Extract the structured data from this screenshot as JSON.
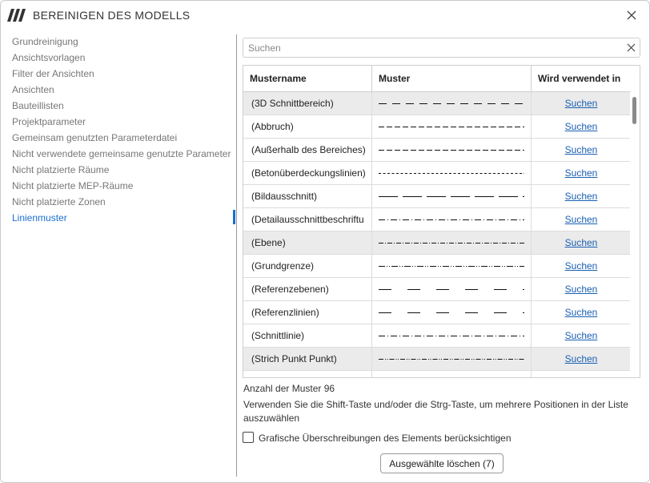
{
  "window": {
    "title": "BEREINIGEN DES MODELLS",
    "logo_icon": "app-logo-icon",
    "close_icon": "close-icon"
  },
  "sidebar": {
    "items": [
      {
        "label": "Grundreinigung",
        "active": false
      },
      {
        "label": "Ansichtsvorlagen",
        "active": false
      },
      {
        "label": "Filter der Ansichten",
        "active": false
      },
      {
        "label": "Ansichten",
        "active": false
      },
      {
        "label": "Bauteillisten",
        "active": false
      },
      {
        "label": "Projektparameter",
        "active": false
      },
      {
        "label": "Gemeinsam genutzten Parameterdatei",
        "active": false
      },
      {
        "label": "Nicht verwendete gemeinsame genutzte Parameter",
        "active": false
      },
      {
        "label": "Nicht platzierte Räume",
        "active": false
      },
      {
        "label": "Nicht platzierte MEP-Räume",
        "active": false
      },
      {
        "label": "Nicht platzierte Zonen",
        "active": false
      },
      {
        "label": "Linienmuster",
        "active": true
      }
    ]
  },
  "search": {
    "placeholder": "Suchen",
    "value": ""
  },
  "table": {
    "columns": [
      "Mustername",
      "Muster",
      "Wird verwendet in"
    ],
    "rows": [
      {
        "name": "(3D Schnittbereich)",
        "pattern": "dash-long",
        "link": "Suchen",
        "selected": true
      },
      {
        "name": "(Abbruch)",
        "pattern": "dash-medium",
        "link": "Suchen",
        "selected": false
      },
      {
        "name": "(Außerhalb des Bereiches)",
        "pattern": "dash-medium",
        "link": "Suchen",
        "selected": false
      },
      {
        "name": "(Betonüberdeckungslinien)",
        "pattern": "dash-short",
        "link": "Suchen",
        "selected": false
      },
      {
        "name": "(Bildausschnitt)",
        "pattern": "dash-xlong",
        "link": "Suchen",
        "selected": false
      },
      {
        "name": "(Detailausschnittbeschriftu",
        "pattern": "dash-dot",
        "link": "Suchen",
        "selected": false
      },
      {
        "name": "(Ebene)",
        "pattern": "dash-dot-dense",
        "link": "Suchen",
        "selected": true
      },
      {
        "name": "(Grundgrenze)",
        "pattern": "dash-dot-dot",
        "link": "Suchen",
        "selected": false
      },
      {
        "name": "(Referenzebenen)",
        "pattern": "dash-sparse",
        "link": "Suchen",
        "selected": false
      },
      {
        "name": "(Referenzlinien)",
        "pattern": "dash-sparse",
        "link": "Suchen",
        "selected": false
      },
      {
        "name": "(Schnittlinie)",
        "pattern": "dash-dot",
        "link": "Suchen",
        "selected": false
      },
      {
        "name": "(Strich Punkt Punkt)",
        "pattern": "dash-dot-dot-dense",
        "link": "Suchen",
        "selected": true
      }
    ]
  },
  "footer": {
    "count_text": "Anzahl der Muster 96",
    "hint": "Verwenden Sie die Shift-Taste und/oder die Strg-Taste, um mehrere Positionen in der Liste auszuwählen",
    "checkbox_label": "Grafische Überschreibungen des Elements berücksichtigen",
    "checkbox_checked": false,
    "delete_label": "Ausgewählte löschen (7)"
  },
  "colors": {
    "accent": "#1a6fd1",
    "link": "#1a5fb4",
    "selected_row": "#ebebeb"
  }
}
